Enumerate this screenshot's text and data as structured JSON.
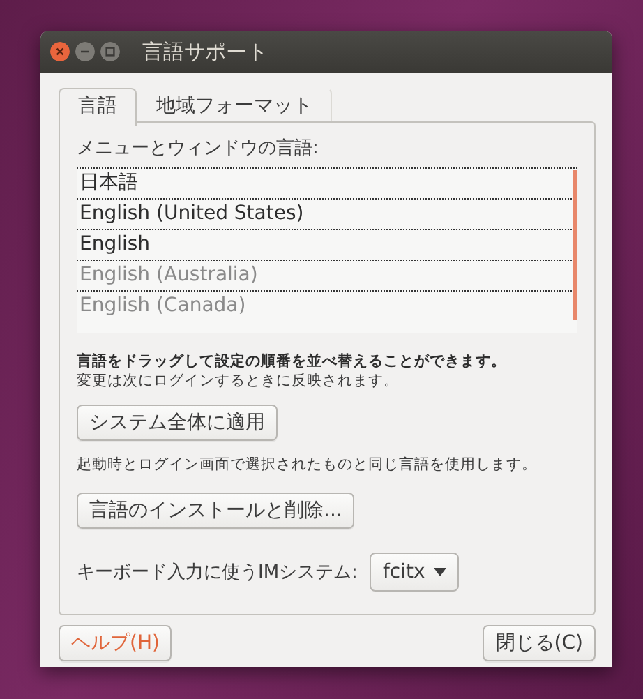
{
  "window": {
    "title": "言語サポート"
  },
  "tabs": [
    {
      "label": "言語",
      "selected": true
    },
    {
      "label": "地域フォーマット",
      "selected": false
    }
  ],
  "languages_label": "メニューとウィンドウの言語:",
  "languages": [
    {
      "name": "日本語",
      "active": true
    },
    {
      "name": "English (United States)",
      "active": true
    },
    {
      "name": "English",
      "active": true
    },
    {
      "name": "English (Australia)",
      "active": false
    },
    {
      "name": "English (Canada)",
      "active": false
    }
  ],
  "drag_hint": "言語をドラッグして設定の順番を並べ替えることができます。",
  "apply_hint": "変更は次にログインするときに反映されます。",
  "apply_button": "システム全体に適用",
  "login_note": "起動時とログイン画面で選択されたものと同じ言語を使用します。",
  "install_button": "言語のインストールと削除...",
  "im": {
    "label": "キーボード入力に使うIMシステム:",
    "value": "fcitx"
  },
  "buttons": [
    {
      "label": "ヘルプ(H)",
      "kind": "help"
    },
    {
      "label": "閉じる(C)",
      "kind": "close"
    }
  ]
}
